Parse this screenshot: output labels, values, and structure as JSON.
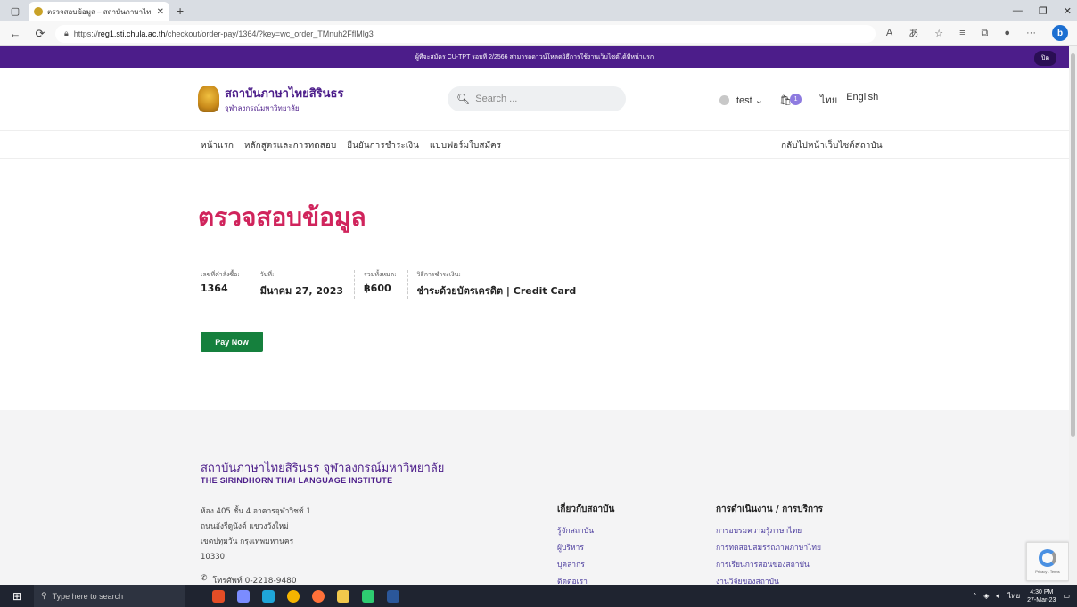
{
  "browser": {
    "tab_title": "ตรวจสอบข้อมูล – สถาบันภาษาไทยสิริ",
    "url_prefix": "https://",
    "url_host": "reg1.sti.chula.ac.th",
    "url_path": "/checkout/order-pay/1364/?key=wc_order_TMnuh2FflMlg3"
  },
  "announcement": {
    "text": "ผู้ที่จะสมัคร CU-TPT รอบที่ 2/2566 สามารถดาวน์โหลดวิธีการใช้งานเว็บไซต์ได้ที่หน้าแรก",
    "close_label": "ปิด"
  },
  "header": {
    "logo_title": "สถาบันภาษาไทยสิรินธร",
    "logo_subtitle": "จุฬาลงกรณ์มหาวิทยาลัย",
    "search_placeholder": "Search ...",
    "user_name": "test",
    "cart_count": "1",
    "lang_th": "ไทย",
    "lang_en": "English"
  },
  "nav": {
    "items": [
      "หน้าแรก",
      "หลักสูตรและการทดสอบ",
      "ยืนยันการชำระเงิน",
      "แบบฟอร์มใบสมัคร"
    ],
    "back_link": "กลับไปหน้าเว็บไซต์สถาบัน"
  },
  "main": {
    "title": "ตรวจสอบข้อมูล",
    "order": [
      {
        "label": "เลขที่คำสั่งซื้อ:",
        "value": "1364"
      },
      {
        "label": "วันที่:",
        "value": "มีนาคม 27, 2023"
      },
      {
        "label": "รวมทั้งหมด:",
        "value": "฿600"
      },
      {
        "label": "วิธีการชำระเงิน:",
        "value": "ชำระด้วยบัตรเครดิต | Credit Card"
      }
    ],
    "pay_button": "Pay Now"
  },
  "footer": {
    "institute_th": "สถาบันภาษาไทยสิรินธร จุฬาลงกรณ์มหาวิทยาลัย",
    "institute_en": "THE SIRINDHORN THAI LANGUAGE INSTITUTE",
    "address": [
      "ห้อง 405 ชั้น 4 อาคารจุฬาวิชช์ 1",
      "ถนนอังรีดูนังต์ แขวงวังใหม่",
      "เขตปทุมวัน กรุงเทพมหานคร",
      "10330"
    ],
    "phone": "โทรศัพท์ 0-2218-9480",
    "about": {
      "heading": "เกี่ยวกับสถาบัน",
      "links": [
        "รู้จักสถาบัน",
        "ผู้บริหาร",
        "บุคลากร",
        "ติดต่อเรา"
      ]
    },
    "services": {
      "heading": "การดำเนินงาน / การบริการ",
      "links": [
        "การอบรมความรู้ภาษาไทย",
        "การทดสอบสมรรถภาพภาษาไทย",
        "การเรียนการสอนของสถาบัน",
        "งานวิจัยของสถาบัน"
      ]
    },
    "recaptcha_text": "Privacy - Terms"
  },
  "taskbar": {
    "search_placeholder": "Type here to search",
    "lang": "ไทย",
    "time": "4:30 PM",
    "date": "27-Mar-23"
  },
  "colors": {
    "brand_purple": "#4c1d8a",
    "title_pink": "#d0245c",
    "pay_green": "#15803d"
  }
}
